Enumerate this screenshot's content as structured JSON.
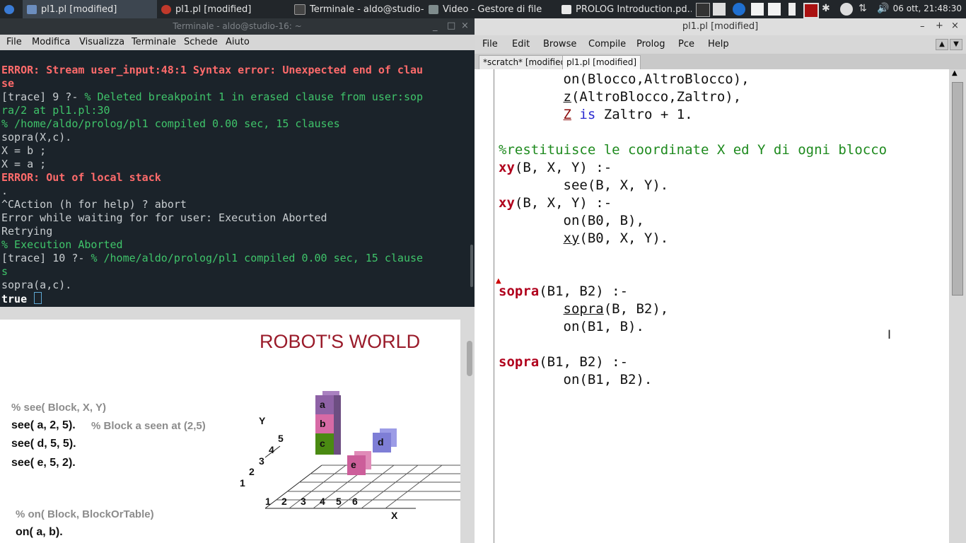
{
  "taskbar": {
    "windows": [
      {
        "label": "pl1.pl [modified]",
        "active": true
      },
      {
        "label": "pl1.pl [modified]",
        "active": false
      },
      {
        "label": "Terminale - aldo@studio-...",
        "active": false
      },
      {
        "label": "Video - Gestore di file",
        "active": false
      },
      {
        "label": "PROLOG Introduction.pd...",
        "active": false
      }
    ],
    "clock": "06 ott, 21:48:30"
  },
  "terminal": {
    "title": "Terminale - aldo@studio-16: ~",
    "menu": [
      "File",
      "Modifica",
      "Visualizza",
      "Terminale",
      "Schede",
      "Aiuto"
    ],
    "lines": [
      {
        "text": "ERROR: Stream user_input:48:1 Syntax error: Unexpected end of clau",
        "style": "err"
      },
      {
        "text": "se",
        "style": "err"
      },
      {
        "text": "[trace] 9 ?- ",
        "style": "plain",
        "extra": "% Deleted breakpoint 1 in erased clause from user:sop"
      },
      {
        "text": "ra/2 at pl1.pl:30",
        "style": "grn"
      },
      {
        "text": "% /home/aldo/prolog/pl1 compiled 0.00 sec, 15 clauses",
        "style": "grn"
      },
      {
        "text": "sopra(X,c).",
        "style": "plain"
      },
      {
        "text": "X = b ;",
        "style": "plain"
      },
      {
        "text": "X = a ;",
        "style": "plain"
      },
      {
        "text": "ERROR: Out of local stack",
        "style": "err"
      },
      {
        "text": ".",
        "style": "plain"
      },
      {
        "text": "^CAction (h for help) ? abort",
        "style": "plain"
      },
      {
        "text": "Error while waiting for for user: Execution Aborted",
        "style": "plain"
      },
      {
        "text": "Retrying",
        "style": "plain"
      },
      {
        "text": "% Execution Aborted",
        "style": "grn"
      },
      {
        "text": "[trace] 10 ?- ",
        "style": "plain",
        "extra": "% /home/aldo/prolog/pl1 compiled 0.00 sec, 15 clause"
      },
      {
        "text": "s",
        "style": "grn"
      },
      {
        "text": "sopra(a,c).",
        "style": "plain"
      },
      {
        "text": "true",
        "style": "wht"
      }
    ]
  },
  "pdf": {
    "title": "ROBOT'S WORLD",
    "see_comment": "%  see( Block, X, Y)",
    "see_facts": [
      "see( a, 2, 5).",
      "see( d, 5, 5).",
      "see( e, 5, 2)."
    ],
    "see_note": "% Block a seen at (2,5)",
    "on_comment": "% on( Block, BlockOrTable)",
    "on_facts": [
      "on( a, b)."
    ],
    "axis_y_label": "Y",
    "axis_x_label": "X",
    "y_ticks": [
      "1",
      "2",
      "3",
      "4",
      "5"
    ],
    "x_ticks": [
      "1",
      "2",
      "3",
      "4",
      "5",
      "6"
    ],
    "blocks": [
      {
        "label": "a",
        "color": "#8e62a6"
      },
      {
        "label": "b",
        "color": "#d76aa5"
      },
      {
        "label": "c",
        "color": "#4a8a12"
      },
      {
        "label": "d",
        "color": "#7e7ed6"
      },
      {
        "label": "e",
        "color": "#cc5e9a"
      }
    ]
  },
  "emacs": {
    "title": "pl1.pl [modified]",
    "menu": [
      "File",
      "Edit",
      "Browse",
      "Compile",
      "Prolog",
      "Pce",
      "Help"
    ],
    "tabs": [
      "*scratch* [modified]",
      "pl1.pl [modified]"
    ],
    "code": {
      "l1": "on(Blocco,AltroBlocco),",
      "l2_pred": "z",
      "l2_rest": "(AltroBlocco,Zaltro),",
      "l3_var": "Z",
      "l3_is": "is",
      "l3_rest": "Zaltro + 1.",
      "comment": "%restituisce le coordinate X ed Y di ogni blocco",
      "xy_head": "xy",
      "xy_args": "(B, X, Y) :-",
      "xy_body1": "see(B, X, Y).",
      "xy_body2": "on(B0, B),",
      "xy_rec_pred": "xy",
      "xy_rec_args": "(B0, X, Y).",
      "sopra_head": "sopra",
      "sopra_args": "(B1, B2) :-",
      "sopra_body1_pred": "sopra",
      "sopra_body1_args": "(B, B2),",
      "sopra_body2": "on(B1, B).",
      "sopra2_body": "on(B1, B2)."
    }
  }
}
